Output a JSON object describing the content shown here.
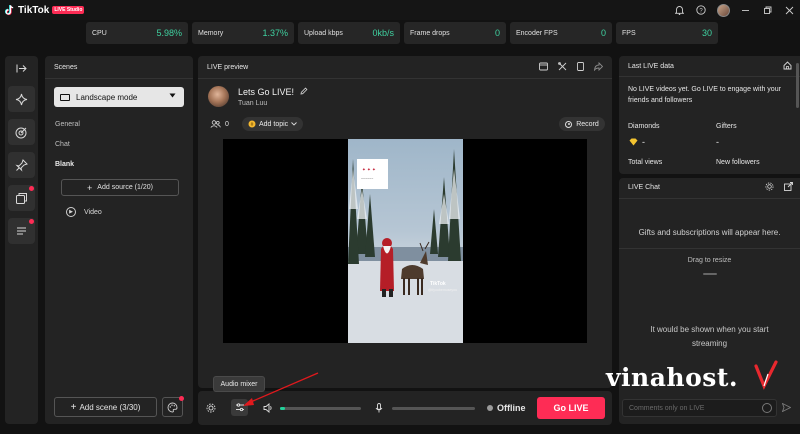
{
  "app": {
    "name": "TikTok",
    "badge": "LIVE Studio"
  },
  "stats": [
    {
      "label": "CPU",
      "value": "5.98%",
      "color": "#3fd1a0"
    },
    {
      "label": "Memory",
      "value": "1.37%",
      "color": "#3fd1a0"
    },
    {
      "label": "Upload kbps",
      "value": "0kb/s",
      "color": "#3fd1a0"
    },
    {
      "label": "Frame drops",
      "value": "0",
      "color": "#3fd1a0"
    },
    {
      "label": "Encoder FPS",
      "value": "0",
      "color": "#3fd1a0"
    },
    {
      "label": "FPS",
      "value": "30",
      "color": "#3fd1a0"
    }
  ],
  "rail": {
    "icons": [
      "collapse-panel-icon",
      "effects-sparkle-icon",
      "goals-target-icon",
      "interactive-pin-icon",
      "games-sticker-icon",
      "comments-text-icon"
    ]
  },
  "scenes": {
    "title": "Scenes",
    "mode": "Landscape mode",
    "categories": [
      "General",
      "Chat",
      "Blank"
    ],
    "add_source": "Add source (1/20)",
    "source_item": "Video",
    "add_scene": "Add scene (3/30)"
  },
  "preview": {
    "title": "LIVE preview",
    "stream_title": "Lets Go LIVE!",
    "host_name": "Tuan Luu",
    "viewer_count": "0",
    "add_topic": "Add topic",
    "record": "Record",
    "video_watermark": "TikTok",
    "video_handle": "@ifyoubemuseyou"
  },
  "controls": {
    "tooltip": "Audio mixer",
    "status": "Offline",
    "go_live": "Go LIVE",
    "speaker_level": 0.06,
    "mic_level": 0.0
  },
  "live_data": {
    "title": "Last LIVE data",
    "message": "No LIVE videos yet.  Go LIVE to engage with your friends and followers",
    "diamonds_label": "Diamonds",
    "diamonds_value": "-",
    "gifters_label": "Gifters",
    "gifters_value": "-",
    "views_label": "Total views",
    "followers_label": "New followers"
  },
  "chat": {
    "title": "LIVE Chat",
    "gifts_notice": "Gifts and subscriptions will appear here.",
    "drag": "Drag to resize",
    "empty_line1": "It would be shown when you start",
    "empty_line2": "streaming",
    "input_placeholder": "Comments only on LIVE"
  },
  "watermark": {
    "brand": "vinahost."
  },
  "colors": {
    "accent": "#fe2c55",
    "positive": "#3fd1a0",
    "panel": "#232323"
  }
}
